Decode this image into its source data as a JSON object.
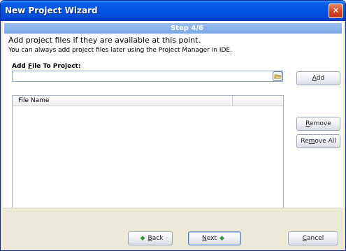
{
  "window": {
    "title": "New Project Wizard",
    "close_glyph": "✕"
  },
  "step": {
    "label": "Step 4/6"
  },
  "intro": {
    "line1": "Add project files if they are available at this point.",
    "line2": "You can always add project files later using the Project Manager in IDE."
  },
  "add_file": {
    "label_pre": "Add ",
    "label_u": "F",
    "label_post": "ile To Project:",
    "value": "",
    "browse_icon": "folder-open-icon"
  },
  "buttons": {
    "add": {
      "pre": "",
      "u": "A",
      "post": "dd"
    },
    "remove": {
      "pre": "",
      "u": "R",
      "post": "emove"
    },
    "remove_all": {
      "pre": "Re",
      "u": "m",
      "post": "ove All"
    },
    "back": {
      "pre": "",
      "u": "B",
      "post": "ack",
      "icon": "◆"
    },
    "next": {
      "pre": "",
      "u": "N",
      "post": "ext",
      "icon": "◆"
    },
    "cancel": {
      "pre": "",
      "u": "C",
      "post": "ancel"
    }
  },
  "file_list": {
    "columns": [
      "File Name",
      ""
    ],
    "rows": []
  },
  "colors": {
    "titlebar": "#0054e3",
    "step_bar": "#7aa7e6",
    "dialog_bg": "#ece9d8",
    "arrow": "#2e9a2e"
  }
}
